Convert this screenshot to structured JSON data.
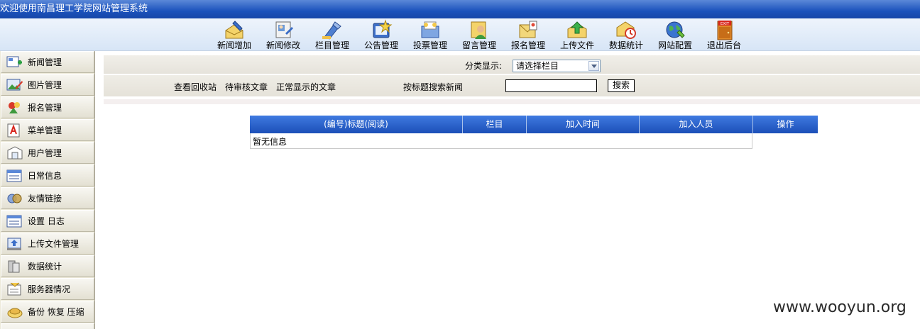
{
  "window": {
    "title": "欢迎使用南昌理工学院网站管理系统"
  },
  "toolbar": {
    "items": [
      {
        "label": "新闻增加",
        "icon": "news-add-icon"
      },
      {
        "label": "新闻修改",
        "icon": "news-edit-icon"
      },
      {
        "label": "栏目管理",
        "icon": "column-manage-icon"
      },
      {
        "label": "公告管理",
        "icon": "notice-manage-icon"
      },
      {
        "label": "投票管理",
        "icon": "vote-manage-icon"
      },
      {
        "label": "留言管理",
        "icon": "message-manage-icon"
      },
      {
        "label": "报名管理",
        "icon": "signup-manage-icon"
      },
      {
        "label": "上传文件",
        "icon": "upload-file-icon"
      },
      {
        "label": "数据统计",
        "icon": "statistics-icon"
      },
      {
        "label": "网站配置",
        "icon": "site-config-icon"
      },
      {
        "label": "退出后台",
        "icon": "exit-icon",
        "badge": "EXIT"
      }
    ]
  },
  "sidebar": {
    "items": [
      {
        "label": "新闻管理",
        "icon": "news-icon"
      },
      {
        "label": "图片管理",
        "icon": "image-icon"
      },
      {
        "label": "报名管理",
        "icon": "signup-icon"
      },
      {
        "label": "菜单管理",
        "icon": "menu-icon"
      },
      {
        "label": "用户管理",
        "icon": "user-icon"
      },
      {
        "label": "日常信息",
        "icon": "daily-info-icon"
      },
      {
        "label": "友情链接",
        "icon": "friend-link-icon"
      },
      {
        "label": "设置 日志",
        "icon": "settings-log-icon"
      },
      {
        "label": "上传文件管理",
        "icon": "upload-manage-icon"
      },
      {
        "label": "数据统计",
        "icon": "data-stat-icon"
      },
      {
        "label": "服务器情况",
        "icon": "server-icon"
      },
      {
        "label": "备份 恢复 压缩",
        "icon": "backup-icon"
      }
    ]
  },
  "filter": {
    "label": "分类显示:",
    "select_value": "请选择栏目"
  },
  "links": {
    "recycle": "查看回收站",
    "pending": "待审核文章",
    "normal": "正常显示的文章",
    "search_label": "按标题搜索新闻",
    "search_value": "",
    "search_button": "搜索"
  },
  "table": {
    "headers": [
      "(编号)标题(阅读)",
      "栏目",
      "加入时间",
      "加入人员",
      "操作"
    ],
    "empty_text": "暂无信息"
  },
  "watermark": "www.wooyun.org",
  "colors": {
    "titlebar": "#1b52bc",
    "table_header": "#2a5fc8",
    "toolbar_bg": "#dfeaf8",
    "sidebar_bg": "#ece9d8"
  }
}
